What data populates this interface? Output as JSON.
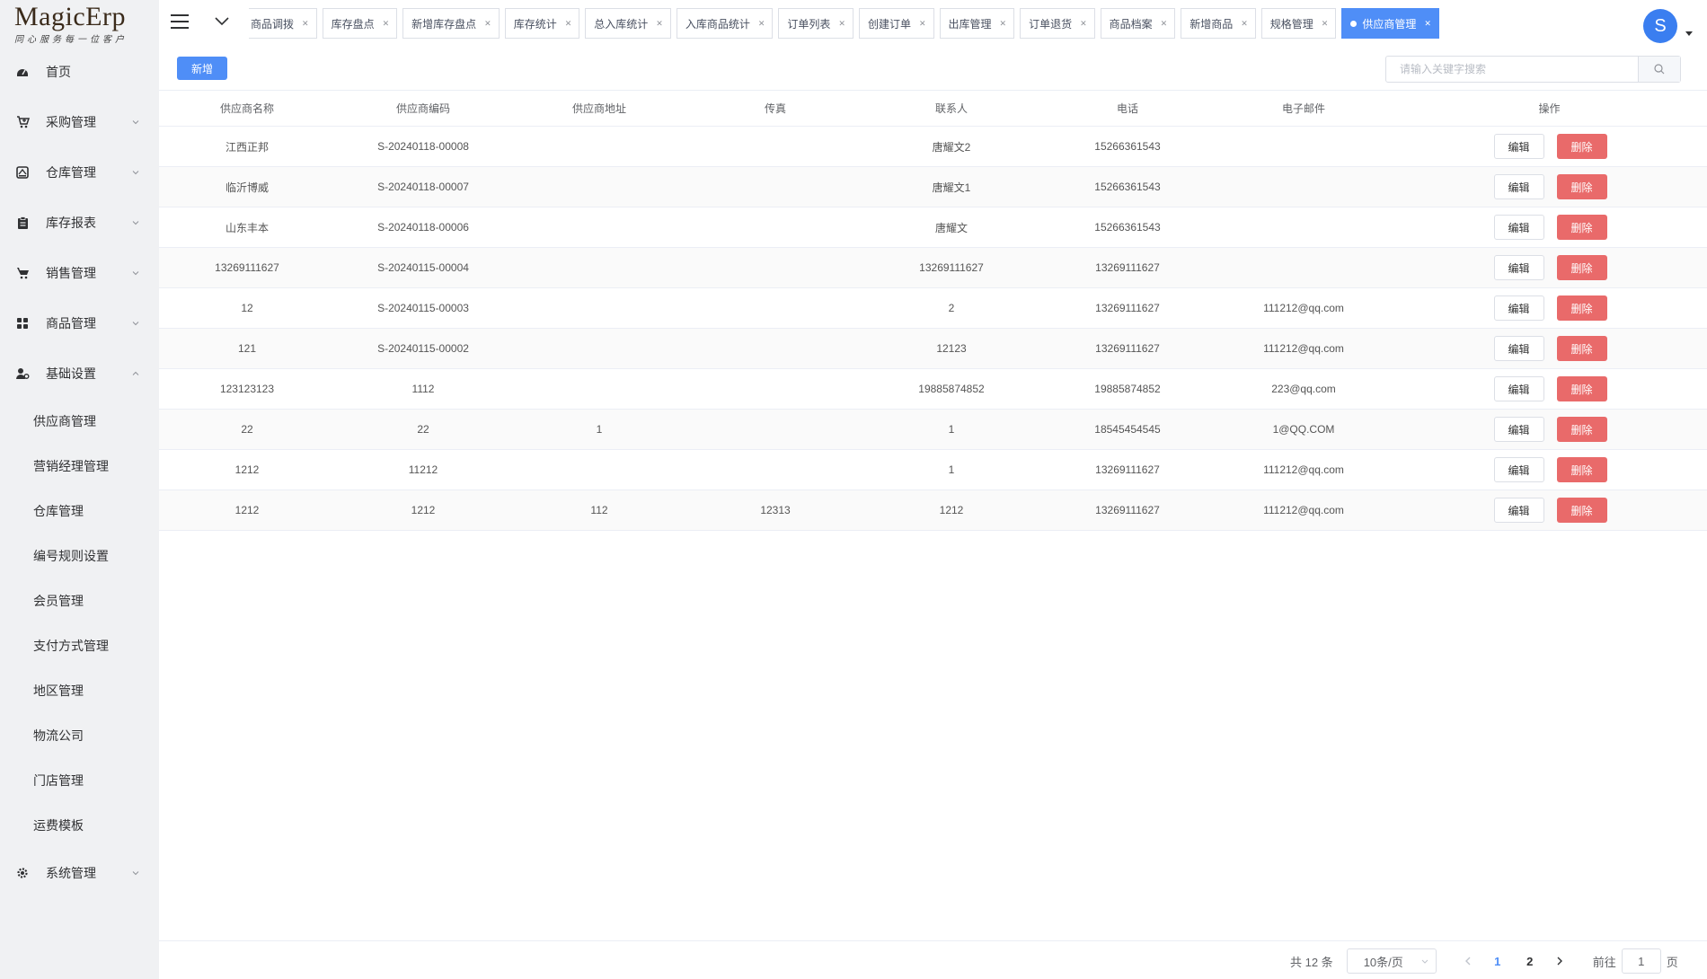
{
  "logo": {
    "title": "MagicErp",
    "subtitle": "同心服务每一位客户"
  },
  "sidebar": {
    "items": [
      {
        "label": "首页",
        "icon": "dashboard-icon",
        "expandable": false
      },
      {
        "label": "采购管理",
        "icon": "cart-plus-icon",
        "expandable": true
      },
      {
        "label": "仓库管理",
        "icon": "warehouse-icon",
        "expandable": true
      },
      {
        "label": "库存报表",
        "icon": "clipboard-icon",
        "expandable": true
      },
      {
        "label": "销售管理",
        "icon": "shopping-cart-icon",
        "expandable": true
      },
      {
        "label": "商品管理",
        "icon": "grid-icon",
        "expandable": true
      },
      {
        "label": "基础设置",
        "icon": "user-gear-icon",
        "expandable": true,
        "expanded": true
      },
      {
        "label": "系统管理",
        "icon": "gear-icon",
        "expandable": true
      }
    ],
    "sub_items": [
      "供应商管理",
      "营销经理管理",
      "仓库管理",
      "编号规则设置",
      "会员管理",
      "支付方式管理",
      "地区管理",
      "物流公司",
      "门店管理",
      "运费模板"
    ]
  },
  "header": {
    "tabs": [
      "商品调拨",
      "库存盘点",
      "新增库存盘点",
      "库存统计",
      "总入库统计",
      "入库商品统计",
      "订单列表",
      "创建订单",
      "出库管理",
      "订单退货",
      "商品档案",
      "新增商品",
      "规格管理",
      "供应商管理"
    ],
    "active_tab": "供应商管理",
    "avatar_letter": "S"
  },
  "toolbar": {
    "add_label": "新增",
    "search_placeholder": "请输入关键字搜索"
  },
  "table": {
    "columns": [
      "供应商名称",
      "供应商编码",
      "供应商地址",
      "传真",
      "联系人",
      "电话",
      "电子邮件",
      "操作"
    ],
    "edit_label": "编辑",
    "delete_label": "删除",
    "rows": [
      [
        "江西正邦",
        "S-20240118-00008",
        "",
        "",
        "唐耀文2",
        "15266361543",
        ""
      ],
      [
        "临沂博威",
        "S-20240118-00007",
        "",
        "",
        "唐耀文1",
        "15266361543",
        ""
      ],
      [
        "山东丰本",
        "S-20240118-00006",
        "",
        "",
        "唐耀文",
        "15266361543",
        ""
      ],
      [
        "13269111627",
        "S-20240115-00004",
        "",
        "",
        "13269111627",
        "13269111627",
        ""
      ],
      [
        "12",
        "S-20240115-00003",
        "",
        "",
        "2",
        "13269111627",
        "111212@qq.com"
      ],
      [
        "121",
        "S-20240115-00002",
        "",
        "",
        "12123",
        "13269111627",
        "111212@qq.com"
      ],
      [
        "123123123",
        "1112",
        "",
        "",
        "19885874852",
        "19885874852",
        "223@qq.com"
      ],
      [
        "22",
        "22",
        "1",
        "",
        "1",
        "18545454545",
        "1@QQ.COM"
      ],
      [
        "1212",
        "11212",
        "",
        "",
        "1",
        "13269111627",
        "111212@qq.com"
      ],
      [
        "1212",
        "1212",
        "112",
        "12313",
        "1212",
        "13269111627",
        "111212@qq.com"
      ]
    ]
  },
  "pagination": {
    "total_text": "共 12 条",
    "page_size": "10条/页",
    "pages": [
      "1",
      "2"
    ],
    "current_page": "1",
    "goto_label": "前往",
    "goto_value": "1",
    "page_unit": "页"
  },
  "colors": {
    "primary": "#4f8ef7",
    "danger": "#e96a6a",
    "sidebar_bg": "#f0f1f3"
  }
}
